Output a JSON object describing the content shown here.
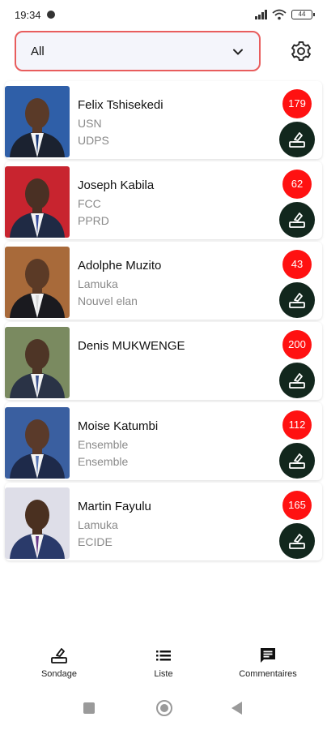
{
  "status_bar": {
    "time": "19:34",
    "battery": "44"
  },
  "filter": {
    "selected": "All"
  },
  "candidates": [
    {
      "name": "Felix Tshisekedi",
      "party": "USN",
      "coalition": "UDPS",
      "count": "179",
      "photo_bg": "#2f5fa8",
      "suit": "#1b2230",
      "skin": "#5a3a28",
      "tie": "#1a3a7a"
    },
    {
      "name": "Joseph Kabila",
      "party": "FCC",
      "coalition": "PPRD",
      "count": "62",
      "photo_bg": "#c8242f",
      "suit": "#1f2a44",
      "skin": "#4a3024",
      "tie": "#3a4fa0"
    },
    {
      "name": "Adolphe Muzito",
      "party": "Lamuka",
      "coalition": "Nouvel elan",
      "count": "43",
      "photo_bg": "#a86a3a",
      "suit": "#1a1a1f",
      "skin": "#5b3a26",
      "tie": "#d8d8d8"
    },
    {
      "name": "Denis MUKWENGE",
      "party": "",
      "coalition": "",
      "count": "200",
      "photo_bg": "#7a8a60",
      "suit": "#2a3346",
      "skin": "#4e3526",
      "tie": "#3f5590"
    },
    {
      "name": "Moise Katumbi",
      "party": "Ensemble",
      "coalition": "Ensemble",
      "count": "112",
      "photo_bg": "#3a5fa0",
      "suit": "#1e2a4a",
      "skin": "#5a3a2a",
      "tie": "#5a78b8"
    },
    {
      "name": "Martin Fayulu",
      "party": "Lamuka",
      "coalition": "ECIDE",
      "count": "165",
      "photo_bg": "#dedee8",
      "suit": "#2a3a6a",
      "skin": "#4a3020",
      "tie": "#6a3a8a"
    }
  ],
  "bottom_nav": [
    {
      "label": "Sondage",
      "icon": "ballot-icon"
    },
    {
      "label": "Liste",
      "icon": "list-icon"
    },
    {
      "label": "Commentaires",
      "icon": "comment-icon"
    }
  ],
  "colors": {
    "badge": "#ff1111",
    "vote_button": "#12271d",
    "filter_border": "#e85d5d"
  }
}
